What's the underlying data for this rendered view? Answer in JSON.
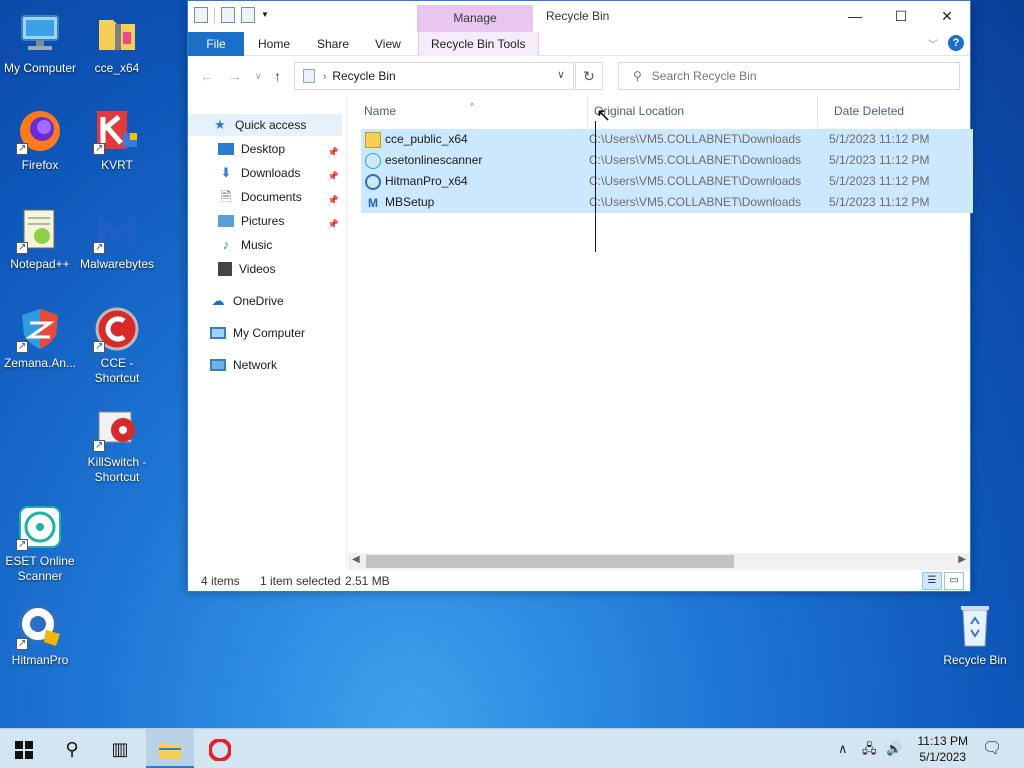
{
  "desktop": {
    "icons": [
      {
        "label": "My Computer"
      },
      {
        "label": "cce_x64"
      },
      {
        "label": "Firefox"
      },
      {
        "label": "KVRT"
      },
      {
        "label": "Notepad++"
      },
      {
        "label": "Malwarebytes"
      },
      {
        "label": "Zemana.An..."
      },
      {
        "label": "CCE - Shortcut"
      },
      {
        "label": "KillSwitch - Shortcut"
      },
      {
        "label": "ESET Online Scanner"
      },
      {
        "label": "HitmanPro"
      },
      {
        "label": "Recycle Bin"
      }
    ]
  },
  "window": {
    "title": "Recycle Bin",
    "context_tab": "Manage",
    "ribbon": {
      "file": "File",
      "home": "Home",
      "share": "Share",
      "view": "View",
      "tools": "Recycle Bin Tools"
    },
    "address": "Recycle Bin",
    "search_placeholder": "Search Recycle Bin",
    "nav": {
      "quick_access": "Quick access",
      "desktop": "Desktop",
      "downloads": "Downloads",
      "documents": "Documents",
      "pictures": "Pictures",
      "music": "Music",
      "videos": "Videos",
      "onedrive": "OneDrive",
      "my_computer": "My Computer",
      "network": "Network"
    },
    "columns": {
      "name": "Name",
      "location": "Original Location",
      "date": "Date Deleted"
    },
    "files": [
      {
        "name": "cce_public_x64",
        "location": "C:\\Users\\VM5.COLLABNET\\Downloads",
        "date": "5/1/2023 11:12 PM"
      },
      {
        "name": "esetonlinescanner",
        "location": "C:\\Users\\VM5.COLLABNET\\Downloads",
        "date": "5/1/2023 11:12 PM"
      },
      {
        "name": "HitmanPro_x64",
        "location": "C:\\Users\\VM5.COLLABNET\\Downloads",
        "date": "5/1/2023 11:12 PM"
      },
      {
        "name": "MBSetup",
        "location": "C:\\Users\\VM5.COLLABNET\\Downloads",
        "date": "5/1/2023 11:12 PM"
      }
    ],
    "status": {
      "count": "4 items",
      "selected": "1 item selected",
      "size": "2.51 MB"
    }
  },
  "taskbar": {
    "time": "11:13 PM",
    "date": "5/1/2023"
  },
  "colors": {
    "accent": "#1a6fc9",
    "selection": "#cce8ff",
    "manage_tab": "#e8c6f0"
  }
}
